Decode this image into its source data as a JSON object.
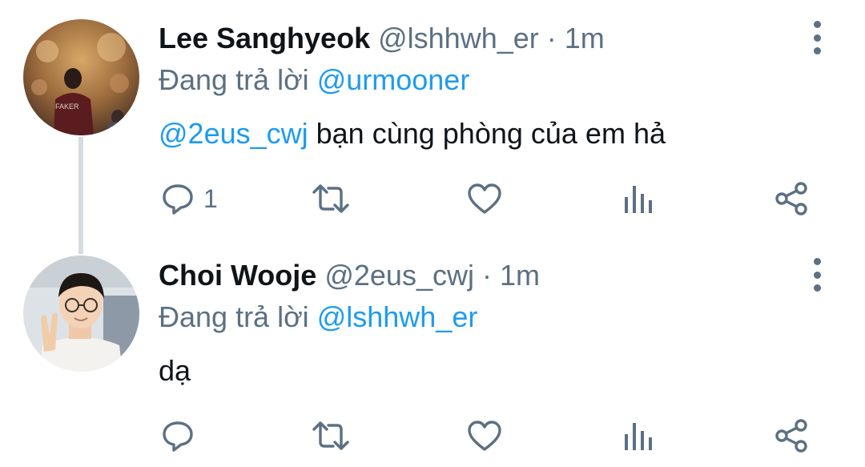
{
  "tweets": [
    {
      "name": "Lee Sanghyeok",
      "handle": "@lshhwh_er",
      "separator": "·",
      "time": "1m",
      "replying_prefix": "Đang trả lời",
      "replying_to": "@urmooner",
      "body_mention": "@2eus_cwj",
      "body_text": " bạn cùng phòng của em hả",
      "reply_count": "1",
      "avatar_label": "FAKER"
    },
    {
      "name": "Choi Wooje",
      "handle": "@2eus_cwj",
      "separator": "·",
      "time": "1m",
      "replying_prefix": "Đang trả lời",
      "replying_to": "@lshhwh_er",
      "body_mention": "",
      "body_text": "dạ",
      "reply_count": ""
    }
  ],
  "icons": {
    "reply": "reply-icon",
    "retweet": "retweet-icon",
    "like": "heart-icon",
    "analytics": "analytics-icon",
    "share": "share-icon",
    "more": "more-vertical-icon"
  },
  "colors": {
    "mention": "#1d9bf0",
    "secondary": "#5b7083",
    "thread_line": "#d6dbe0"
  }
}
